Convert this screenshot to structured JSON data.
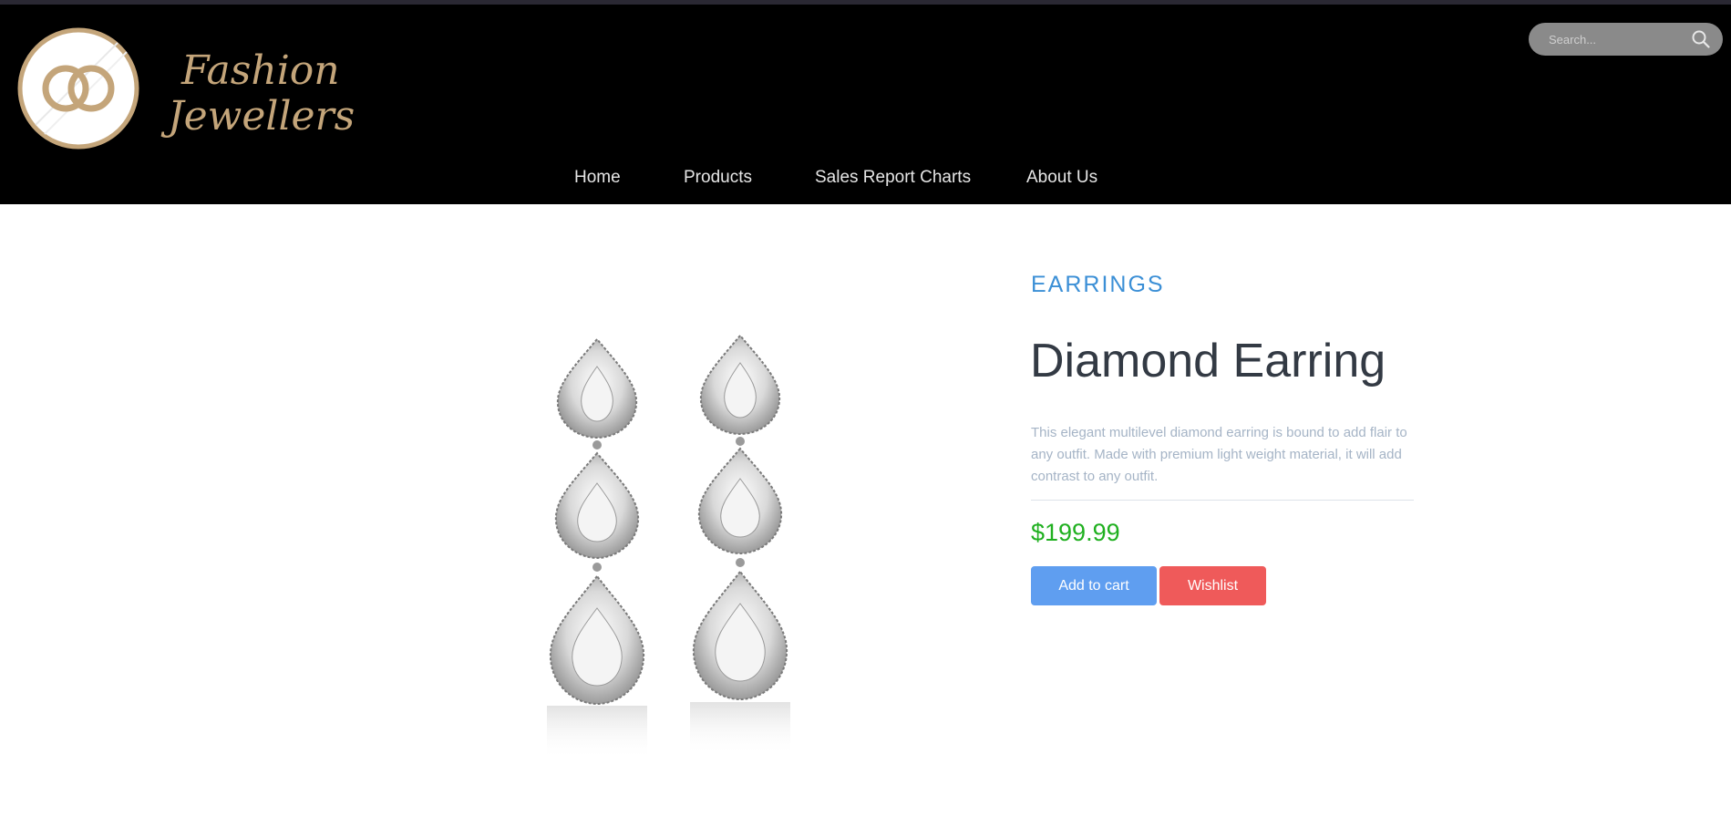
{
  "brand": {
    "line1": "Fashion",
    "line2": "Jewellers",
    "color": "#c4a57a"
  },
  "search": {
    "placeholder": "Search...",
    "icon": "search-icon"
  },
  "nav": {
    "items": [
      {
        "label": "Home"
      },
      {
        "label": "Products"
      },
      {
        "label": "Sales Report Charts"
      },
      {
        "label": "About Us"
      }
    ]
  },
  "product": {
    "category": "EARRINGS",
    "name": "Diamond Earring",
    "description": "This elegant multilevel diamond earring is bound to add flair to any outfit. Made with premium light weight material, it will add contrast to any outfit.",
    "price": "$199.99",
    "image": "diamond-earrings-image"
  },
  "actions": {
    "add_to_cart": "Add to cart",
    "wishlist": "Wishlist"
  },
  "colors": {
    "header_bg": "#000000",
    "category": "#3b8fd6",
    "price": "#20b020",
    "cart_button": "#5f9ef0",
    "wishlist_button": "#ef5a5a"
  }
}
